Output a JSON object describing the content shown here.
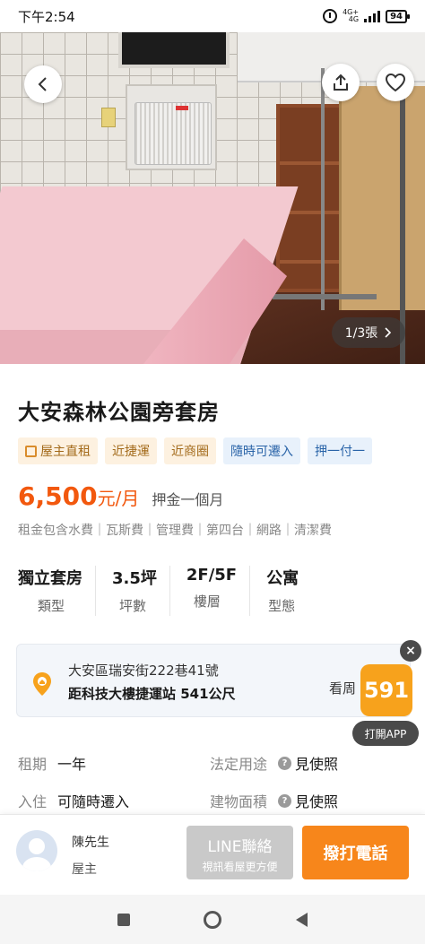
{
  "status_bar": {
    "time": "下午2:54",
    "network": "4G+",
    "network_sub": "4G",
    "battery": "94"
  },
  "photo": {
    "counter": "1/3張"
  },
  "listing": {
    "title": "大安森林公園旁套房",
    "tags": [
      "屋主直租",
      "近捷運",
      "近商圈",
      "隨時可遷入",
      "押一付一"
    ],
    "price": "6,500",
    "price_unit": "元/月",
    "deposit": "押金一個月",
    "includes": "租金包含水費｜瓦斯費｜管理費｜第四台｜網路｜清潔費",
    "stats": [
      {
        "value": "獨立套房",
        "label": "類型"
      },
      {
        "value": "3.5坪",
        "label": "坪數"
      },
      {
        "value": "2F/5F",
        "label": "樓層"
      },
      {
        "value": "公寓",
        "label": "型態"
      }
    ],
    "address": "大安區瑞安街222巷41號",
    "transit": "距科技大樓捷運站 541公尺",
    "map_link": "看周",
    "details": [
      {
        "key": "租期",
        "value": "一年"
      },
      {
        "key": "法定用途",
        "value": "見使照"
      },
      {
        "key": "入住",
        "value": "可隨時遷入"
      },
      {
        "key": "建物面積",
        "value": "見使照"
      }
    ]
  },
  "promo": {
    "logo": "591",
    "label": "打開APP",
    "close": "×"
  },
  "contact": {
    "name": "陳先生",
    "role": "屋主",
    "line_label": "LINE聯絡",
    "line_sub": "視訊看屋更方便",
    "call_label": "撥打電話"
  },
  "colors": {
    "accent": "#f2580e",
    "call": "#f7861b",
    "tag_blue": "#2a64a8",
    "tag_orange": "#a36a1a"
  }
}
